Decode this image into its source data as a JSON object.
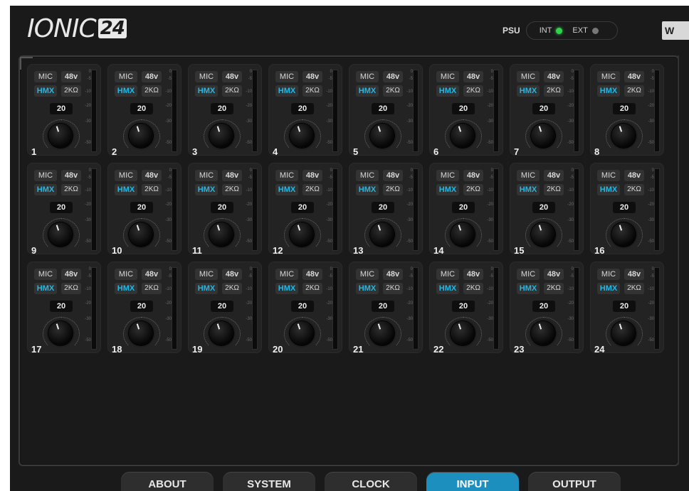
{
  "header": {
    "logo_text": "IONIC",
    "logo_number": "24",
    "psu_label": "PSU",
    "int_label": "INT",
    "ext_label": "EXT",
    "int_status": "on",
    "ext_status": "off",
    "brand_partial": "W"
  },
  "channel_labels": {
    "mic": "MIC",
    "phantom": "48v",
    "hmx": "HMX",
    "impedance": "2KΩ"
  },
  "meter_scale": [
    "0",
    "-5",
    "-10",
    "-20",
    "-30",
    "-50"
  ],
  "channels": [
    {
      "number": "1",
      "gain": "20"
    },
    {
      "number": "2",
      "gain": "20"
    },
    {
      "number": "3",
      "gain": "20"
    },
    {
      "number": "4",
      "gain": "20"
    },
    {
      "number": "5",
      "gain": "20"
    },
    {
      "number": "6",
      "gain": "20"
    },
    {
      "number": "7",
      "gain": "20"
    },
    {
      "number": "8",
      "gain": "20"
    },
    {
      "number": "9",
      "gain": "20"
    },
    {
      "number": "10",
      "gain": "20"
    },
    {
      "number": "11",
      "gain": "20"
    },
    {
      "number": "12",
      "gain": "20"
    },
    {
      "number": "13",
      "gain": "20"
    },
    {
      "number": "14",
      "gain": "20"
    },
    {
      "number": "15",
      "gain": "20"
    },
    {
      "number": "16",
      "gain": "20"
    },
    {
      "number": "17",
      "gain": "20"
    },
    {
      "number": "18",
      "gain": "20"
    },
    {
      "number": "19",
      "gain": "20"
    },
    {
      "number": "20",
      "gain": "20"
    },
    {
      "number": "21",
      "gain": "20"
    },
    {
      "number": "22",
      "gain": "20"
    },
    {
      "number": "23",
      "gain": "20"
    },
    {
      "number": "24",
      "gain": "20"
    }
  ],
  "nav": {
    "tabs": [
      {
        "label": "ABOUT",
        "active": false
      },
      {
        "label": "SYSTEM",
        "active": false
      },
      {
        "label": "CLOCK",
        "active": false
      },
      {
        "label": "INPUT",
        "active": true
      },
      {
        "label": "OUTPUT",
        "active": false
      }
    ]
  },
  "colors": {
    "accent": "#1d8fbf",
    "hmx": "#22b8e6",
    "led_on": "#2ed34a",
    "led_off": "#777777"
  }
}
